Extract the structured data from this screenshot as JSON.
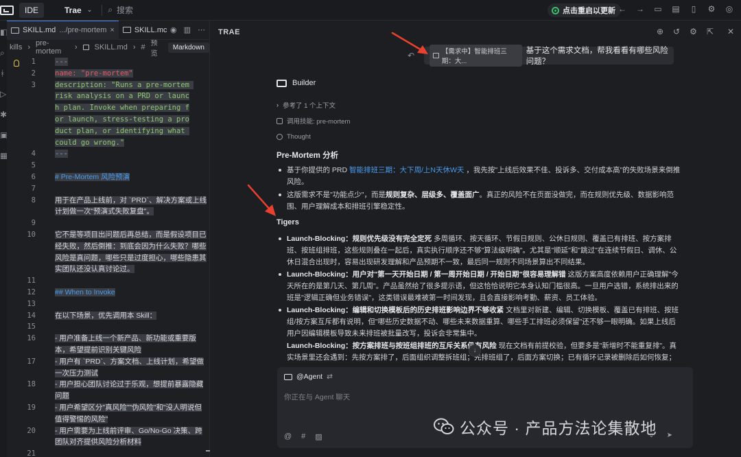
{
  "titlebar": {
    "ide_label": "IDE",
    "app_name": "Trae",
    "search_placeholder": "搜索",
    "update_label": "点击重启以更新"
  },
  "editor": {
    "tabs": [
      {
        "name": "SKILL.md",
        "path": ".../pre-mortem"
      },
      {
        "name": "SKILL.mc"
      }
    ],
    "breadcrumb": [
      "kills",
      "pre-mortem",
      "SKILL.md",
      "#"
    ],
    "preview_label": "预览",
    "mode_label": "Markdown",
    "lines": [
      {
        "n": "1",
        "text": "---"
      },
      {
        "n": "2",
        "text": "name: \"pre-mortem\""
      },
      {
        "n": "3",
        "text": "description: \"Runs a pre-mortem risk analysis on a PRD or launch plan. Invoke when preparing for launch, stress-testing a product plan, or identifying what could go wrong.\""
      },
      {
        "n": "4",
        "text": "---"
      },
      {
        "n": "5",
        "text": ""
      },
      {
        "n": "6",
        "text": "# Pre-Mortem 风险预演"
      },
      {
        "n": "7",
        "text": ""
      },
      {
        "n": "8",
        "text": "用于在产品上线前，对 `PRD`、解决方案或上线计划做一次\"预演式失败复盘\"。"
      },
      {
        "n": "9",
        "text": ""
      },
      {
        "n": "10",
        "text": "它不是等项目出问题后再总结，而是假设项目已经失败，然后倒推：到底会因为什么失败？哪些风险是真问题，哪些只是过度担心，哪些隐患其实团队还没认真讨论过。"
      },
      {
        "n": "11",
        "text": ""
      },
      {
        "n": "12",
        "text": "## When to Invoke"
      },
      {
        "n": "13",
        "text": ""
      },
      {
        "n": "14",
        "text": "在以下场景，优先调用本 Skill："
      },
      {
        "n": "15",
        "text": ""
      },
      {
        "n": "16",
        "text": "- 用户准备上线一个新产品、新功能或重要版本，希望提前识别关键风险"
      },
      {
        "n": "17",
        "text": "- 用户有 `PRD`、方案文档、上线计划，希望做一次压力测试"
      },
      {
        "n": "18",
        "text": "- 用户担心团队讨论过于乐观，想提前暴露隐藏问题"
      },
      {
        "n": "19",
        "text": "- 用户希望区分\"真风险\"\"伪风险\"和\"没人明说但值得警惕的风险\""
      },
      {
        "n": "20",
        "text": "- 用户需要为上线前评审、Go/No-Go 决策、跨团队对齐提供风险分析材料"
      },
      {
        "n": "21",
        "text": ""
      }
    ]
  },
  "chat": {
    "header": "TRAE",
    "user_message": {
      "ref_chip": "【需求中】智能排班三期：大...",
      "text": "基于这个需求文档，帮我看看有哪些风险问题？"
    },
    "agent_name": "Builder",
    "meta": [
      {
        "icon": "chevron",
        "text": "参考了 1 个上下文"
      },
      {
        "icon": "skill",
        "text": "调用技能: pre-mortem"
      },
      {
        "icon": "thought",
        "text": "Thought"
      }
    ],
    "section_title": "Pre-Mortem 分析",
    "intro_bullets": [
      {
        "pre": "基于你提供的 PRD ",
        "link": "智能排班三期：大下周/上N天休W天",
        "post": " ，我先按\"上线后效果不佳、投诉多、交付成本高\"的失败场景来倒推风险。"
      },
      {
        "pre": "这版需求不是\"功能点少\"，而是",
        "bold": "规则复杂、层级多、覆盖面广",
        "post": "。真正的风险不在页面没做完，而在规则优先级、数据影响范围、用户理解成本和排班引擎稳定性。"
      }
    ],
    "tigers_title": "Tigers",
    "tigers": [
      {
        "bold": "Launch-Blocking：规则优先级没有完全定死",
        "text": " 多周循环、按天循环、节假日规则、公休日规则、覆盖已有排班、按方案排班、按班组排班，这些规则叠在一起后，真实执行顺序还不够\"算法级明确\"。尤其是\"顺延\"和\"跳过\"在连续节假日、调休、公休日混合出现时，容易出现研发理解和产品预期不一致，最后同一规则不同场景算出不同结果。"
      },
      {
        "bold": "Launch-Blocking：用户对\"第一天开始日期 / 第一周开始日期 / 开始日期\"很容易理解错",
        "text": " 这版方案高度依赖用户正确理解\"今天所在的是第几天、第几周\"。产品虽然给了很多提示语，但这恰恰说明它本身认知门槛很高。一旦用户选错，系统排出来的班是\"逻辑正确但业务错误\"，这类错误最难被第一时间发现，且会直接影响考勤、薪资、员工体验。"
      },
      {
        "bold": "Launch-Blocking：编辑和切换模板后的历史排班影响边界不够收紧",
        "text": " 文档里对新建、编辑、切换模板、覆盖已有排班、按班组/按方案互斥都有说明，但\"哪些历史数据不动、哪些未来数据重算、哪些手工排班必须保留\"还不够一眼明确。如果上线后用户因编辑模板导致未来排班被批量改写，投诉会非常集中。"
      },
      {
        "bold": "Launch-Blocking：按方案排班与按班组排班的互斥关系仍有风险",
        "text": " 现在文档有前提校验，但要多是\"新增时不能重复排\"。真实场景里还会遇到：先按方案排了，后面组织调整拆班组；先排班组了，后面方案切换；已有循环记录被删除后如何恢复；排班方案"
      }
    ],
    "composer": {
      "mention": "@Agent",
      "placeholder": "你正在与 Agent 聊天"
    }
  },
  "watermark": {
    "text": "公众号 · 产品方法论集散地"
  }
}
